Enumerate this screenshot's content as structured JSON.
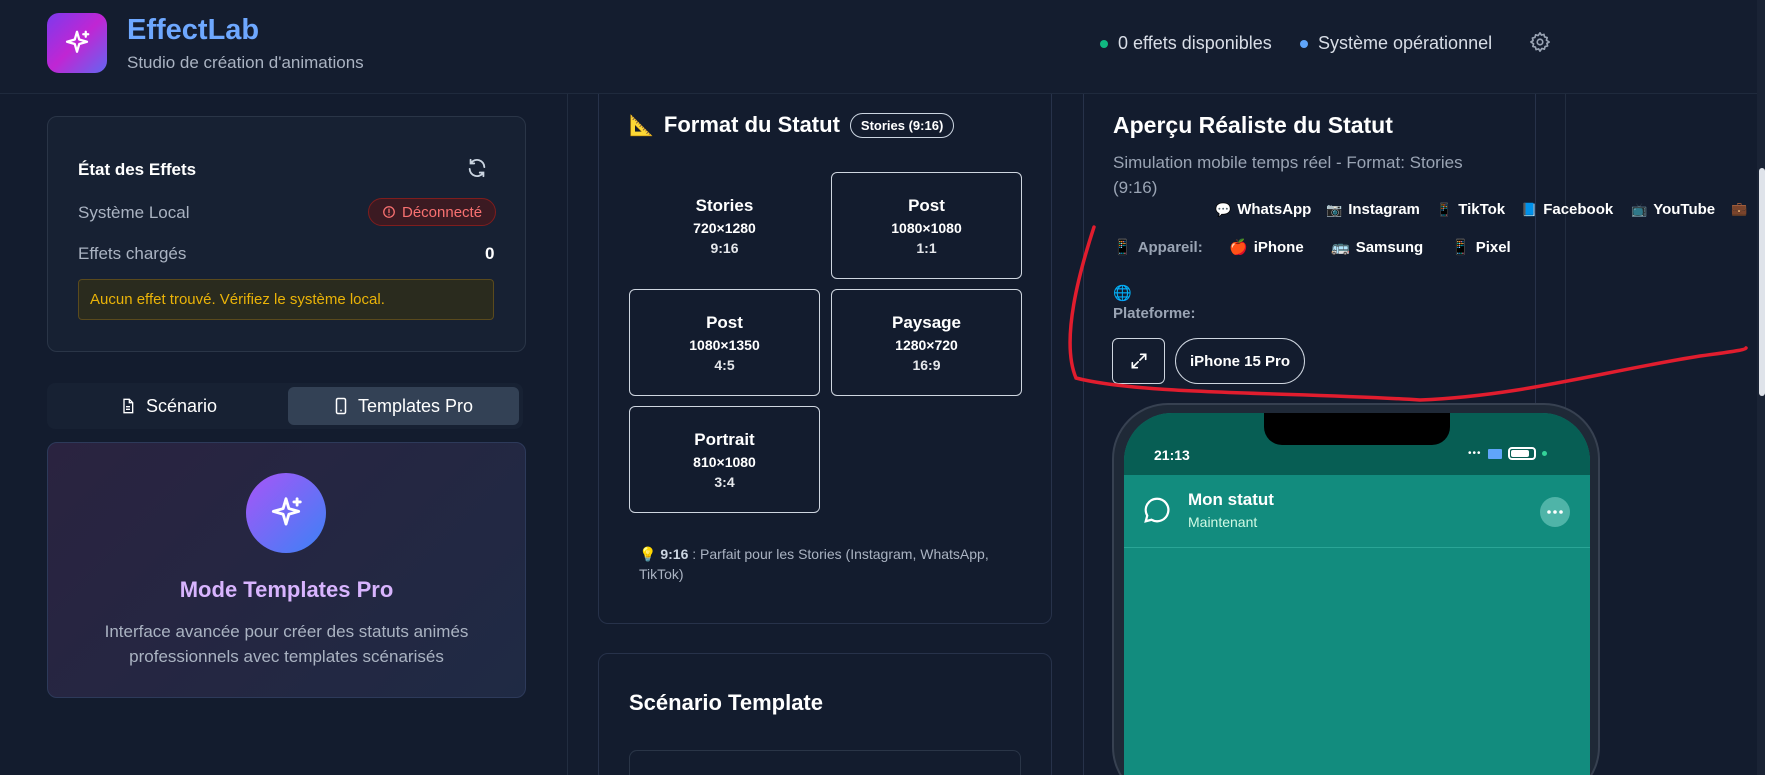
{
  "header": {
    "app_title": "EffectLab",
    "app_subtitle": "Studio de création d'animations",
    "status_effects": "0 effets disponibles",
    "status_system": "Système opérationnel",
    "colors": {
      "effects_dot": "#10b981",
      "system_dot": "#60a5fa"
    }
  },
  "effects_card": {
    "title": "État des Effets",
    "local_label": "Système Local",
    "local_status": "Déconnecté",
    "loaded_label": "Effets chargés",
    "loaded_count": "0",
    "warning": "Aucun effet trouvé. Vérifiez le système local."
  },
  "tabs": [
    {
      "label": "Scénario",
      "icon": "document-icon",
      "active": false
    },
    {
      "label": "Templates Pro",
      "icon": "phone-icon",
      "active": true
    }
  ],
  "pro_card": {
    "title": "Mode Templates Pro",
    "description": "Interface avancée pour créer des statuts animés professionnels avec templates scénarisés"
  },
  "format_card": {
    "icon": "📐",
    "title": "Format du Statut",
    "badge": "Stories (9:16)",
    "options": [
      {
        "name": "Stories",
        "res": "720×1280",
        "ratio": "9:16",
        "selected": true
      },
      {
        "name": "Post",
        "res": "1080×1080",
        "ratio": "1:1",
        "selected": false
      },
      {
        "name": "Post",
        "res": "1080×1350",
        "ratio": "4:5",
        "selected": false
      },
      {
        "name": "Paysage",
        "res": "1280×720",
        "ratio": "16:9",
        "selected": false
      },
      {
        "name": "Portrait",
        "res": "810×1080",
        "ratio": "3:4",
        "selected": false
      }
    ],
    "tip_icon": "💡",
    "tip_bold": "9:16",
    "tip_text": " : Parfait pour les Stories (Instagram, WhatsApp, TikTok)"
  },
  "scenario_card": {
    "title": "Scénario Template"
  },
  "preview_card": {
    "title": "Aperçu Réaliste du Statut",
    "subtitle": "Simulation mobile temps réel - Format: Stories (9:16)",
    "device_label": "Appareil:",
    "devices": [
      {
        "icon": "🍎",
        "label": "iPhone"
      },
      {
        "icon": "🚌",
        "label": "Samsung"
      },
      {
        "icon": "📱",
        "label": "Pixel"
      }
    ],
    "platform_label": "Plateforme:",
    "platforms": [
      {
        "icon": "💬",
        "label": "WhatsApp"
      },
      {
        "icon": "📷",
        "label": "Instagram"
      },
      {
        "icon": "📱",
        "label": "TikTok"
      },
      {
        "icon": "📘",
        "label": "Facebook"
      },
      {
        "icon": "📺",
        "label": "YouTube"
      },
      {
        "icon": "💼",
        "label": ""
      }
    ],
    "model": "iPhone 15 Pro"
  },
  "phone": {
    "time": "21:13",
    "chat_title": "Mon statut",
    "chat_sub": "Maintenant",
    "colors": {
      "header": "#075e54",
      "body": "#128c7e"
    }
  }
}
